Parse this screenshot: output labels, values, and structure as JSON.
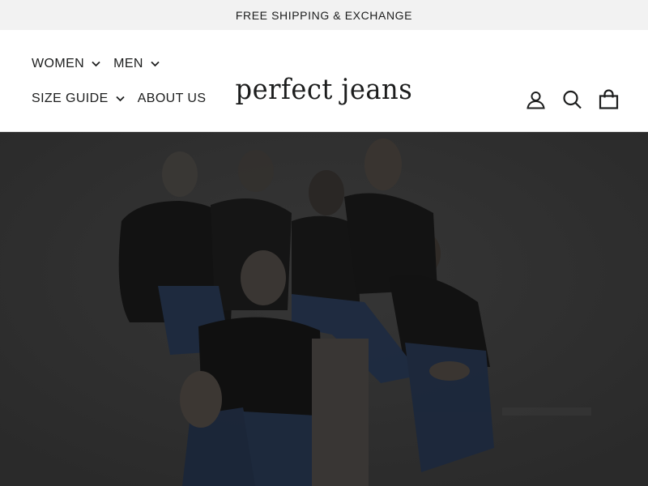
{
  "announcement": {
    "text": "FREE SHIPPING & EXCHANGE"
  },
  "nav": {
    "items": [
      {
        "label": "WOMEN",
        "has_dropdown": true
      },
      {
        "label": "MEN",
        "has_dropdown": true
      },
      {
        "label": "SIZE GUIDE",
        "has_dropdown": true
      },
      {
        "label": "ABOUT US",
        "has_dropdown": false
      }
    ]
  },
  "logo": {
    "text": "perfect jeans"
  },
  "header_icons": [
    "account-icon",
    "search-icon",
    "cart-icon"
  ],
  "hero": {
    "image": "group-photo-in-black-tees-and-jeans",
    "overlay_color": "#2d2d2d"
  },
  "colors": {
    "text": "#1c1d1d",
    "announcement_bg": "#f2f2f2",
    "hero_bg": "#2d2d2d"
  }
}
